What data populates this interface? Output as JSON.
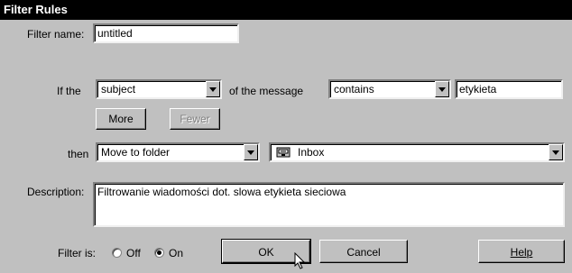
{
  "window": {
    "title": "Filter Rules"
  },
  "filter_name": {
    "label": "Filter name:",
    "value": "untitled"
  },
  "condition": {
    "prefix": "If the",
    "field_select": "subject",
    "middle": "of the message",
    "operator_select": "contains",
    "value": "etykieta"
  },
  "buttons": {
    "more": "More",
    "fewer": "Fewer",
    "ok": "OK",
    "cancel": "Cancel",
    "help": "Help"
  },
  "action": {
    "prefix": "then",
    "action_select": "Move to folder",
    "folder_select": "Inbox"
  },
  "description": {
    "label": "Description:",
    "value": "Filtrowanie wiadomości dot. slowa etykieta sieciowa"
  },
  "filter_is": {
    "label": "Filter is:",
    "off": "Off",
    "on": "On",
    "selected": "On"
  },
  "icons": {
    "folder": "inbox-folder-icon",
    "cursor": "mouse-pointer-icon"
  }
}
